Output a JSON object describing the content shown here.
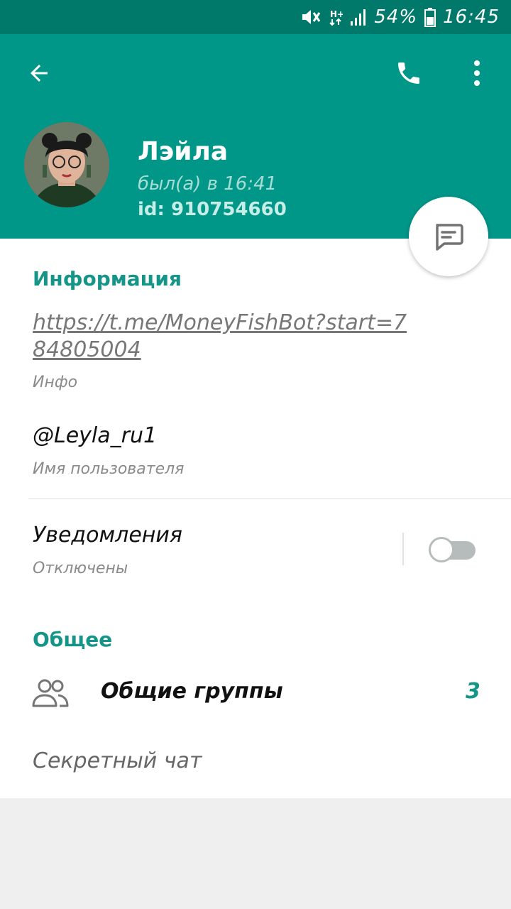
{
  "status_bar": {
    "battery": "54%",
    "time": "16:45"
  },
  "header": {
    "name": "Лэйла",
    "last_seen": "был(а) в 16:41",
    "id": "id: 910754660",
    "accent": "#009688",
    "status_color": "#00796b"
  },
  "icons": {
    "back": "back-arrow-icon",
    "call": "phone-icon",
    "more": "more-vert-icon",
    "message": "message-icon",
    "groups": "groups-icon"
  },
  "info": {
    "title": "Информация",
    "link": "https://t.me/MoneyFishBot?start=784805004",
    "link_label": "Инфо",
    "username": "@Leyla_ru1",
    "username_label": "Имя пользователя",
    "notifications_title": "Уведомления",
    "notifications_status": "Отключены",
    "notifications_enabled": false
  },
  "common": {
    "title": "Общее",
    "groups_label": "Общие группы",
    "groups_count": "3",
    "secret_chat": "Секретный чат"
  }
}
